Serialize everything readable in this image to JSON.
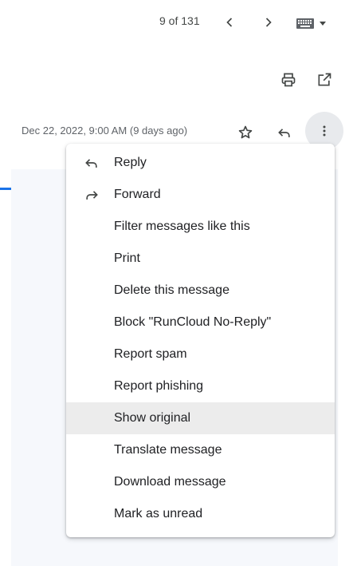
{
  "header": {
    "pager_text": "9 of 131",
    "prev_icon": "chevron-left-icon",
    "next_icon": "chevron-right-icon",
    "input_tools_icon": "keyboard-icon"
  },
  "toolbar": {
    "print_icon": "print-icon",
    "open_new_window_icon": "open-in-new-icon"
  },
  "message": {
    "date_text": "Dec 22, 2022, 9:00 AM (9 days ago)",
    "star_icon": "star-outline-icon",
    "reply_icon": "reply-icon",
    "more_icon": "more-vert-icon"
  },
  "menu": {
    "items": [
      {
        "label": "Reply",
        "icon": "reply-icon"
      },
      {
        "label": "Forward",
        "icon": "forward-icon"
      },
      {
        "label": "Filter messages like this"
      },
      {
        "label": "Print"
      },
      {
        "label": "Delete this message"
      },
      {
        "label": "Block \"RunCloud No-Reply\""
      },
      {
        "label": "Report spam"
      },
      {
        "label": "Report phishing"
      },
      {
        "label": "Show original",
        "highlighted": true
      },
      {
        "label": "Translate message"
      },
      {
        "label": "Download message"
      },
      {
        "label": "Mark as unread"
      }
    ]
  },
  "colors": {
    "accent_blue": "#1a73e8",
    "highlight_bg": "#ececec",
    "more_button_bg": "#e8eaed"
  }
}
